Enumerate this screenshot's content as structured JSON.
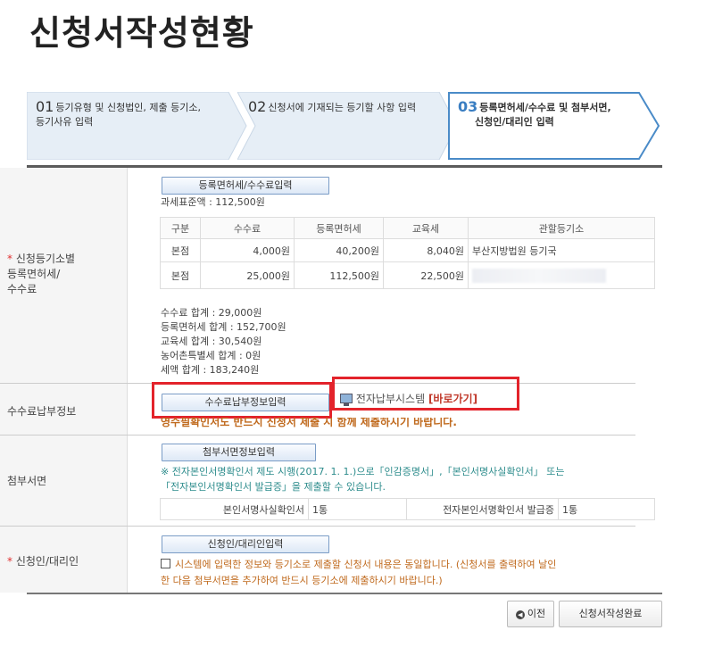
{
  "page": {
    "title": "신청서작성현황"
  },
  "steps": [
    {
      "num": "01",
      "line1": "등기유형 및 신청법인, 제출 등기소,",
      "line2": "등기사유 입력"
    },
    {
      "num": "02",
      "line1": "신청서에 기재되는 등기할 사항 입력",
      "line2": ""
    },
    {
      "num": "03",
      "line1": "등록면허세/수수료 및 첨부서면,",
      "line2": "신청인/대리인 입력"
    }
  ],
  "fee_section": {
    "label_line1": "신청등기소별",
    "label_line2": "등록면허세/",
    "label_line3": "수수료",
    "required_mark": "*",
    "button": "등록면허세/수수료입력",
    "tax_base": "과세표준액 : 112,500원",
    "columns": [
      "구분",
      "수수료",
      "등록면허세",
      "교육세",
      "관할등기소"
    ],
    "rows": [
      [
        "본점",
        "4,000원",
        "40,200원",
        "8,040원",
        "부산지방법원 등기국"
      ],
      [
        "본점",
        "25,000원",
        "112,500원",
        "22,500원",
        ""
      ]
    ],
    "totals": [
      "수수료 합계 : 29,000원",
      "등록면허세 합계 : 152,700원",
      "교육세 합계 : 30,540원",
      "농어촌특별세 합계 : 0원",
      "세액 합계 : 183,240원"
    ]
  },
  "payment_section": {
    "label": "수수료납부정보",
    "button": "수수료납부정보입력",
    "system_link_text": "전자납부시스템",
    "system_link_action": "[바로가기]",
    "notice": "영수필확인서도 반드시 신청서 제출 시 함께 제출하시기 바랍니다."
  },
  "attachments_section": {
    "label": "첨부서면",
    "button": "첨부서면정보입력",
    "notice_line1": "※ 전자본인서명확인서 제도 시행(2017. 1. 1.)으로「인감증명서」,「본인서명사실확인서」 또는",
    "notice_line2": "「전자본인서명확인서 발급증」을 제출할 수 있습니다.",
    "docs": [
      {
        "name": "본인서명사실확인서",
        "count": "1통"
      },
      {
        "name": "전자본인서명확인서 발급증",
        "count": "1통"
      }
    ]
  },
  "applicant_section": {
    "label": "신청인/대리인",
    "required_mark": "*",
    "button": "신청인/대리인입력",
    "agree_line1": "시스템에 입력한 정보와 등기소로 제출할 신청서 내용은 동일합니다. (신청서를 출력하여 날인",
    "agree_line2": "한 다음 첨부서면을 추가하여 반드시 등기소에 제출하시기 바랍니다.)"
  },
  "footer": {
    "prev_label": "이전",
    "complete_label": "신청서작성완료"
  },
  "colors": {
    "highlight": "#e3232b",
    "active_step_border": "#4a8bc8",
    "step_fill": "#e6eef6",
    "notice_green": "#2d8c8c",
    "notice_orange": "#c06a1e"
  }
}
